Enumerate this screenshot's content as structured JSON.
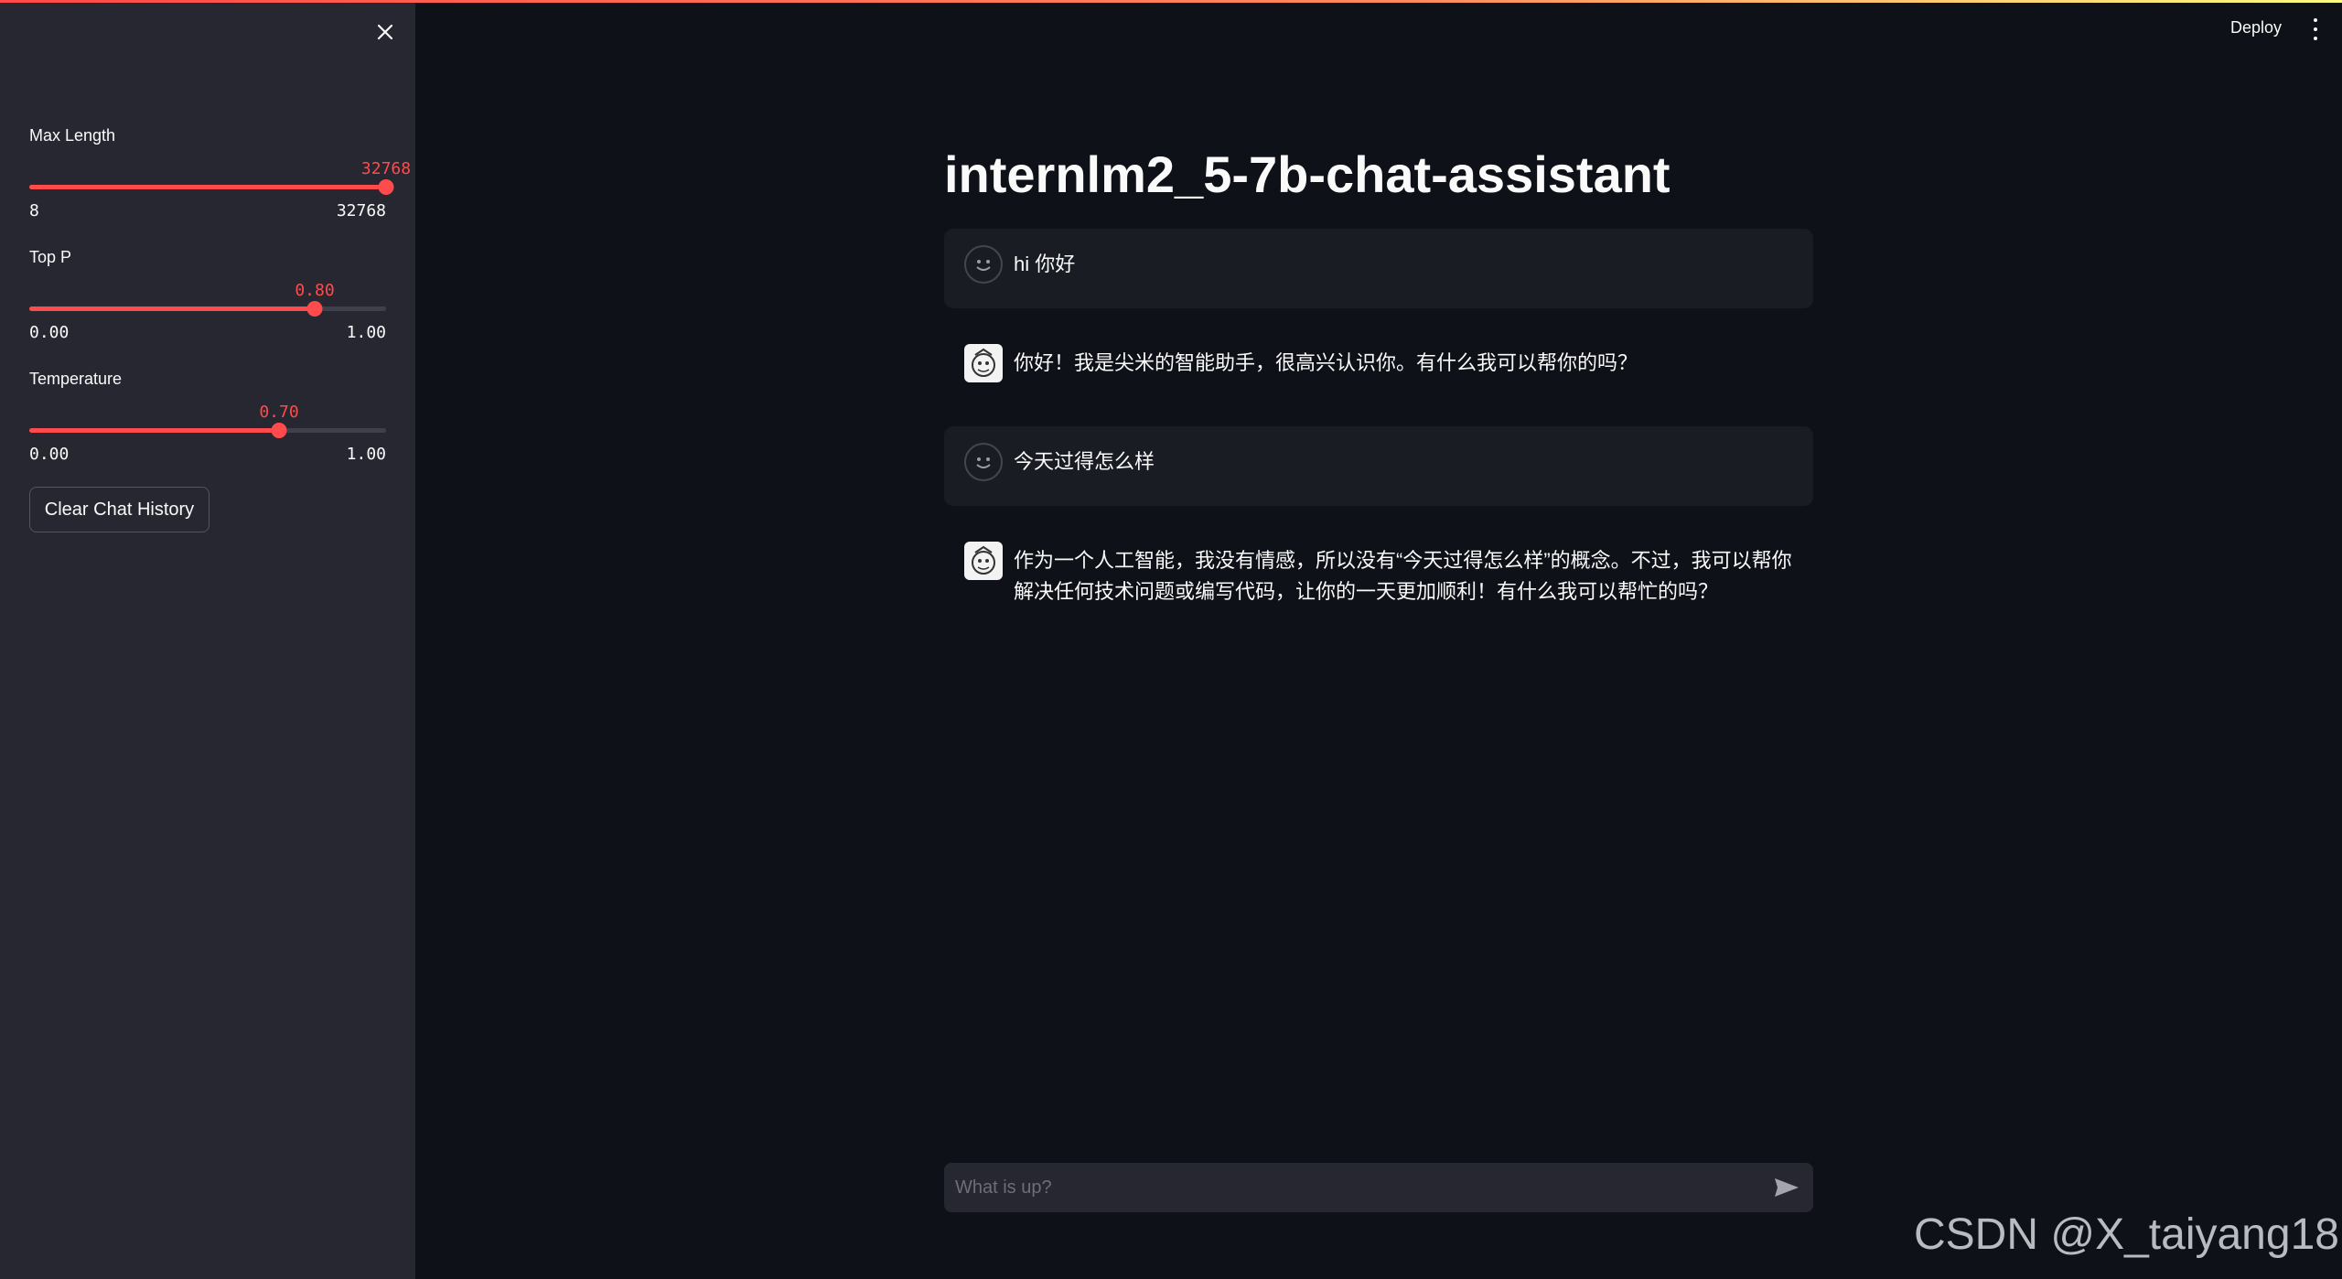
{
  "sidebar": {
    "sliders": [
      {
        "label": "Max Length",
        "value": "32768",
        "min": "8",
        "max": "32768",
        "fraction": 1.0
      },
      {
        "label": "Top P",
        "value": "0.80",
        "min": "0.00",
        "max": "1.00",
        "fraction": 0.8
      },
      {
        "label": "Temperature",
        "value": "0.70",
        "min": "0.00",
        "max": "1.00",
        "fraction": 0.7
      }
    ],
    "clear_button": "Clear Chat History"
  },
  "header": {
    "deploy": "Deploy"
  },
  "main": {
    "title": "internlm2_5-7b-chat-assistant",
    "messages": [
      {
        "role": "user",
        "text": "hi 你好"
      },
      {
        "role": "assistant",
        "text": "你好！我是尖米的智能助手，很高兴认识你。有什么我可以帮你的吗？"
      },
      {
        "role": "user",
        "text": "今天过得怎么样"
      },
      {
        "role": "assistant",
        "text": "作为一个人工智能，我没有情感，所以没有“今天过得怎么样”的概念。不过，我可以帮你解决任何技术问题或编写代码，让你的一天更加顺利！有什么我可以帮忙的吗？"
      }
    ],
    "chat_input": {
      "placeholder": "What is up?"
    }
  },
  "watermark": "CSDN @X_taiyang18",
  "colors": {
    "accent": "#ff4b4b",
    "background": "#0e1117",
    "sidebar": "#262730"
  }
}
